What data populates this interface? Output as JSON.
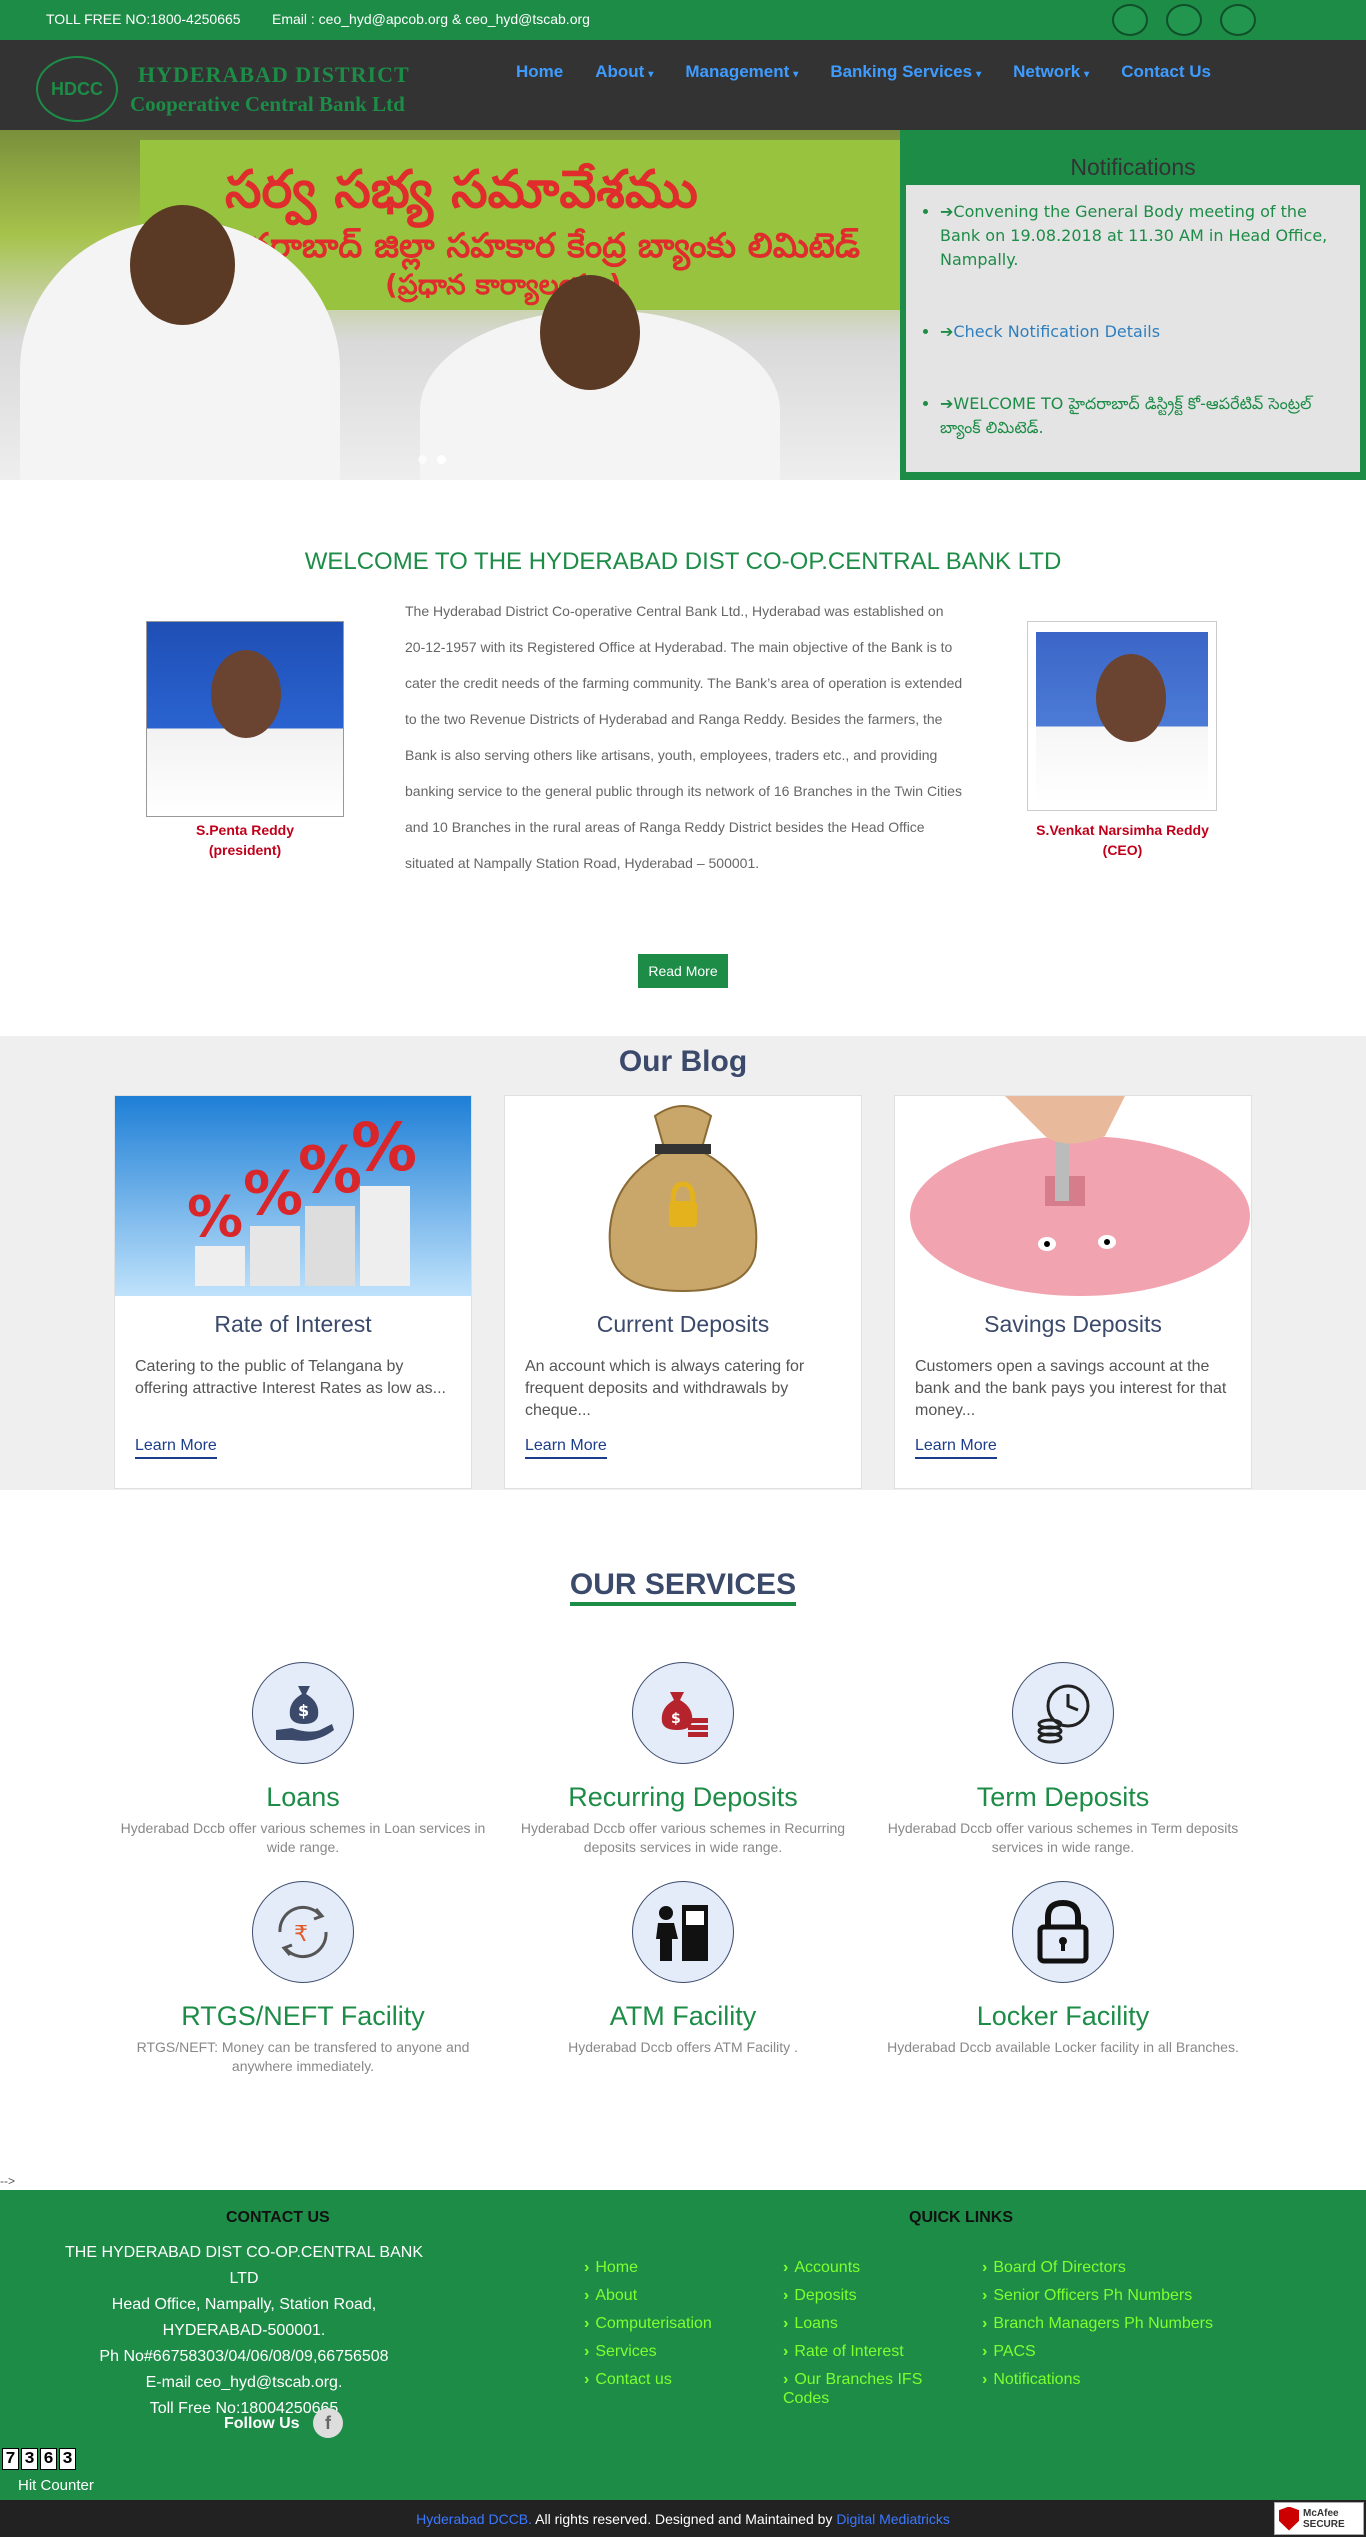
{
  "topbar": {
    "toll_free": "TOLL FREE NO:1800-4250665",
    "email": "Email : ceo_hyd@apcob.org & ceo_hyd@tscab.org"
  },
  "header": {
    "brand_line1": "HYDERABAD DISTRICT",
    "brand_line2": "Cooperative Central Bank Ltd",
    "logo_text": "HDCC"
  },
  "nav": [
    {
      "label": "Home",
      "dropdown": false
    },
    {
      "label": "About",
      "dropdown": true
    },
    {
      "label": "Management",
      "dropdown": true
    },
    {
      "label": "Banking Services",
      "dropdown": true
    },
    {
      "label": "Network",
      "dropdown": true
    },
    {
      "label": "Contact Us",
      "dropdown": false
    }
  ],
  "banner": {
    "text_line1": "సర్వ సభ్య సమావేశము",
    "text_line2": "ది హైదరాబాద్ జిల్లా సహకార కేంద్ర బ్యాంకు లిమిటెడ్",
    "text_line3": "(ప్రధాన కార్యాలయం)"
  },
  "notifications": {
    "title": "Notifications",
    "items": [
      "Convening the General Body meeting of the Bank on 19.08.2018 at 11.30 AM in Head Office, Nampally.",
      "Check Notification Details",
      "WELCOME TO హైదరాబాద్ డిస్ట్రిక్ట్ కో-ఆపరేటివ్ సెంట్రల్ బ్యాంక్ లిమిటెడ్."
    ]
  },
  "welcome": {
    "title": "WELCOME TO THE HYDERABAD DIST CO-OP.CENTRAL BANK LTD",
    "president_name": "S.Penta Reddy",
    "president_role": "(president)",
    "ceo_name": "S.Venkat Narsimha Reddy",
    "ceo_role": "(CEO)",
    "body": "The Hyderabad District Co-operative Central Bank Ltd., Hyderabad was established on 20-12-1957 with its Registered Office at Hyderabad. The main objective of the Bank is to cater the credit needs of the farming community. The Bank’s area of operation is extended to the two Revenue Districts of Hyderabad and Ranga Reddy. Besides the farmers, the Bank is also serving others like artisans, youth, employees, traders etc., and providing banking service to the general public through its network of 16 Branches in the Twin Cities and 10 Branches in the rural areas of Ranga Reddy District besides the Head Office situated at Nampally Station Road, Hyderabad – 500001.",
    "read_more": "Read More"
  },
  "blog": {
    "title": "Our Blog",
    "cards": [
      {
        "title": "Rate of Interest",
        "text": "Catering to the public of Telangana by offering attractive Interest Rates as low as...",
        "link": "Learn More"
      },
      {
        "title": "Current Deposits",
        "text": "An account which is always catering for frequent deposits and withdrawals by cheque...",
        "link": "Learn More"
      },
      {
        "title": "Savings Deposits",
        "text": "Customers open a savings account at the bank and the bank pays you interest for that money...",
        "link": "Learn More"
      }
    ]
  },
  "services": {
    "title": "OUR SERVICES",
    "items": [
      {
        "title": "Loans",
        "text": "Hyderabad Dccb offer various schemes in Loan services in wide range.",
        "icon": "money-bag-hand-icon"
      },
      {
        "title": "Recurring Deposits",
        "text": "Hyderabad Dccb offer various schemes in Recurring deposits services in wide range.",
        "icon": "money-bag-coins-icon"
      },
      {
        "title": "Term Deposits",
        "text": "Hyderabad Dccb offer various schemes in Term deposits services in wide range.",
        "icon": "clock-coins-icon"
      },
      {
        "title": "RTGS/NEFT Facility",
        "text": "RTGS/NEFT: Money can be transfered to anyone and anywhere immediately.",
        "icon": "rupee-transfer-icon"
      },
      {
        "title": "ATM Facility",
        "text": "Hyderabad Dccb offers ATM Facility .",
        "icon": "atm-icon"
      },
      {
        "title": "Locker Facility",
        "text": "Hyderabad Dccb available Locker facility in all Branches.",
        "icon": "padlock-icon"
      }
    ]
  },
  "stray_text": "-->",
  "footer": {
    "contact_title": "CONTACT US",
    "contact_lines": [
      "THE HYDERABAD DIST CO-OP.CENTRAL BANK LTD",
      "Head Office, Nampally, Station Road,",
      "HYDERABAD-500001.",
      "Ph No#66758303/04/06/08/09,66756508",
      "E-mail ceo_hyd@tscab.org.",
      "Toll Free No:18004250665"
    ],
    "follow_label": "Follow Us",
    "quick_title": "QUICK LINKS",
    "quick_col1": [
      "Home",
      "About",
      "Computerisation",
      "Services",
      "Contact us"
    ],
    "quick_col2": [
      "Accounts",
      "Deposits",
      "Loans",
      "Rate of Interest",
      "Our Branches IFS Codes"
    ],
    "quick_col3": [
      "Board Of Directors",
      "Senior Officers Ph Numbers",
      "Branch Managers Ph Numbers",
      "PACS",
      "Notifications"
    ]
  },
  "counter": {
    "digits": [
      "7",
      "3",
      "6",
      "3"
    ],
    "label": "Hit Counter"
  },
  "bottombar": {
    "brand": "Hyderabad DCCB.",
    "rights": " All rights reserved. Designed and Maintained by ",
    "agency": "Digital Mediatricks",
    "mcafee_line1": "McAfee",
    "mcafee_line2": "SECURE"
  },
  "colors": {
    "primary_green": "#1d8c47",
    "nav_blue": "#3f9cff",
    "header_dark": "#333333",
    "heading_navy": "#3b4a6b"
  }
}
